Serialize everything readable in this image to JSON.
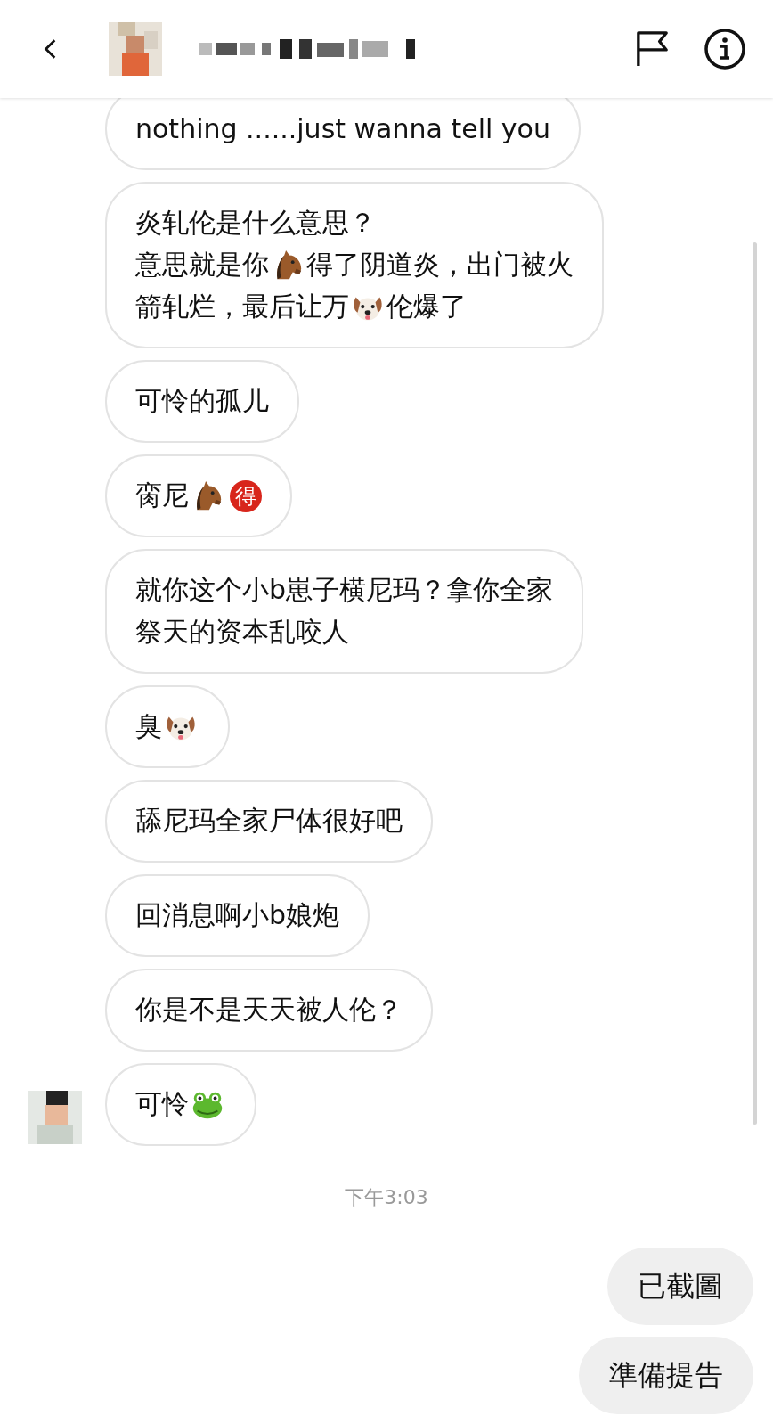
{
  "messages": [
    {
      "kind": "incoming",
      "lines": [
        [
          {
            "kind": "text",
            "text": "nothing ......just wanna tell you"
          }
        ]
      ]
    },
    {
      "kind": "incoming",
      "lines": [
        [
          {
            "kind": "text",
            "text": "炎轧伦是什么意思？"
          }
        ],
        [
          {
            "kind": "text",
            "text": "意思就是你"
          },
          {
            "kind": "horse"
          },
          {
            "kind": "text",
            "text": "得了阴道炎，出门被火"
          }
        ],
        [
          {
            "kind": "text",
            "text": "箭轧烂，最后让万"
          },
          {
            "kind": "dog"
          },
          {
            "kind": "text",
            "text": "伦爆了"
          }
        ]
      ]
    },
    {
      "kind": "incoming",
      "lines": [
        [
          {
            "kind": "text",
            "text": "可怜的孤儿"
          }
        ]
      ]
    },
    {
      "kind": "incoming",
      "lines": [
        [
          {
            "kind": "text",
            "text": "脔尼"
          },
          {
            "kind": "horse"
          },
          {
            "kind": "badge",
            "text": "得"
          }
        ]
      ]
    },
    {
      "kind": "incoming",
      "lines": [
        [
          {
            "kind": "text",
            "text": "就你这个小b崽子横尼玛？拿你全家"
          }
        ],
        [
          {
            "kind": "text",
            "text": "祭天的资本乱咬人"
          }
        ]
      ]
    },
    {
      "kind": "incoming",
      "lines": [
        [
          {
            "kind": "text",
            "text": "臭"
          },
          {
            "kind": "dog"
          }
        ]
      ]
    },
    {
      "kind": "incoming",
      "lines": [
        [
          {
            "kind": "text",
            "text": "舔尼玛全家尸体很好吧"
          }
        ]
      ]
    },
    {
      "kind": "incoming",
      "lines": [
        [
          {
            "kind": "text",
            "text": "回消息啊小b娘炮"
          }
        ]
      ]
    },
    {
      "kind": "incoming",
      "lines": [
        [
          {
            "kind": "text",
            "text": "你是不是天天被人伦？"
          }
        ]
      ]
    },
    {
      "kind": "incoming",
      "avatar": true,
      "lines": [
        [
          {
            "kind": "text",
            "text": "可怜"
          },
          {
            "kind": "frog"
          }
        ]
      ]
    },
    {
      "kind": "timestamp",
      "text": "下午3:03"
    },
    {
      "kind": "outgoing",
      "lines": [
        [
          {
            "kind": "text",
            "text": "已截圖"
          }
        ]
      ]
    },
    {
      "kind": "outgoing",
      "lines": [
        [
          {
            "kind": "text",
            "text": "準備提告"
          }
        ]
      ]
    }
  ]
}
